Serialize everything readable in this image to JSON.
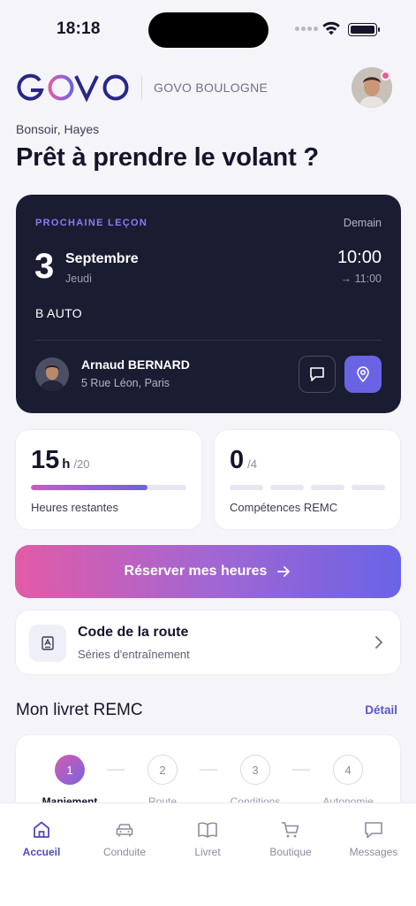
{
  "status_bar": {
    "time": "18:18"
  },
  "header": {
    "logo_text": "GOVO",
    "school_name": "GOVO BOULOGNE"
  },
  "greeting": "Bonsoir, Hayes",
  "headline": "Prêt à prendre le volant ?",
  "next_lesson": {
    "tag": "PROCHAINE LEÇON",
    "relative_day": "Demain",
    "day_number": "3",
    "month": "Septembre",
    "weekday": "Jeudi",
    "start_time": "10:00",
    "end_time": "→ 11:00",
    "category": "B AUTO",
    "instructor_name": "Arnaud BERNARD",
    "instructor_address": "5 Rue Léon, Paris"
  },
  "stats": {
    "hours": {
      "value": "15",
      "unit": "h",
      "total": "/20",
      "label": "Heures restantes",
      "progress": 0.75
    },
    "skills": {
      "value": "0",
      "total": "/4",
      "label": "Compétences REMC",
      "segments": 4,
      "completed": 0
    }
  },
  "cta": {
    "label": "Réserver mes heures"
  },
  "code_card": {
    "title": "Code de la route",
    "subtitle": "Séries d'entraînement"
  },
  "livret": {
    "title": "Mon livret REMC",
    "link": "Détail",
    "steps": [
      {
        "number": "1",
        "name": "Maniement"
      },
      {
        "number": "2",
        "name": "Route"
      },
      {
        "number": "3",
        "name": "Conditions"
      },
      {
        "number": "4",
        "name": "Autonomie"
      }
    ]
  },
  "tabs": [
    {
      "label": "Accueil",
      "icon": "home-icon",
      "active": true
    },
    {
      "label": "Conduite",
      "icon": "car-icon",
      "active": false
    },
    {
      "label": "Livret",
      "icon": "book-icon",
      "active": false
    },
    {
      "label": "Boutique",
      "icon": "cart-icon",
      "active": false
    },
    {
      "label": "Messages",
      "icon": "chat-icon",
      "active": false
    }
  ],
  "colors": {
    "accent": "#6a64e4",
    "pink": "#e25ba6",
    "dark_card": "#1a1c31",
    "background": "#f5f5f9"
  }
}
